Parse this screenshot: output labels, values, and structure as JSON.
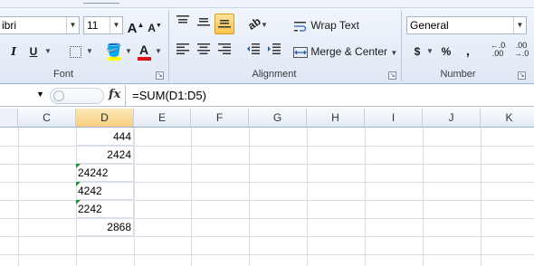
{
  "ribbon": {
    "font_group": {
      "font_name": "ibri",
      "font_size": "11",
      "grow_font": "A",
      "shrink_font": "A",
      "italic": "I",
      "underline": "U",
      "font_color_letter": "A",
      "label": "Font"
    },
    "alignment_group": {
      "wrap_text": "Wrap Text",
      "merge_center": "Merge & Center",
      "label": "Alignment"
    },
    "number_group": {
      "format": "General",
      "currency": "$",
      "percent": "%",
      "comma": ",",
      "increase_decimal_top": "←.0",
      "increase_decimal_bottom": ".00",
      "decrease_decimal_top": ".00",
      "decrease_decimal_bottom": "→.0",
      "label": "Number"
    }
  },
  "formula_bar": {
    "fx": "fx",
    "formula": "=SUM(D1:D5)"
  },
  "columns": [
    "C",
    "D",
    "E",
    "F",
    "G",
    "H",
    "I",
    "J",
    "K"
  ],
  "selected_column": "D",
  "column_d_cells": [
    {
      "value": "444",
      "align": "right",
      "text_number_flag": false
    },
    {
      "value": "2424",
      "align": "right",
      "text_number_flag": false
    },
    {
      "value": "24242",
      "align": "left",
      "text_number_flag": true
    },
    {
      "value": "4242",
      "align": "left",
      "text_number_flag": true
    },
    {
      "value": "2242",
      "align": "left",
      "text_number_flag": true
    },
    {
      "value": "2868",
      "align": "right",
      "text_number_flag": false
    }
  ],
  "colors": {
    "active_button": "#ffc54d",
    "font_color_bar": "#e01010",
    "fill_color_bar": "#ffff00",
    "error_indicator": "#1f8f3a"
  }
}
